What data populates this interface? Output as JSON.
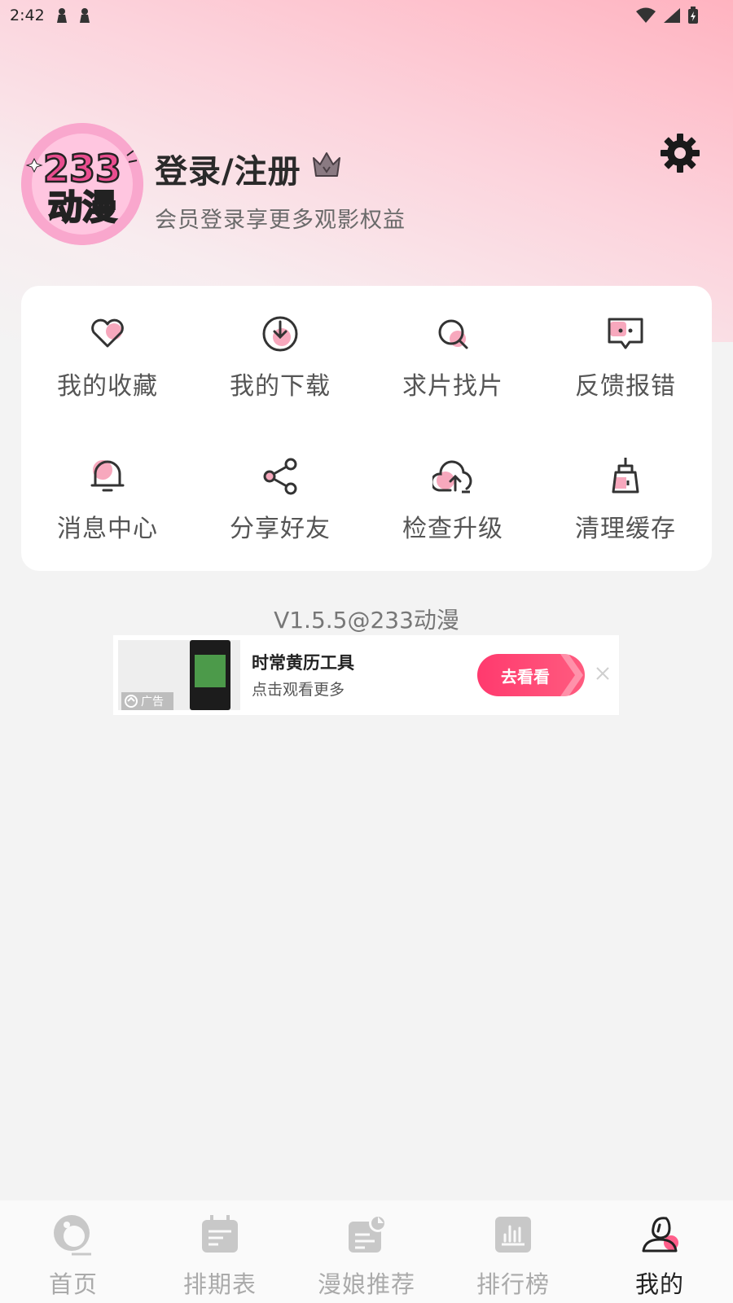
{
  "status_bar": {
    "time": "2:42"
  },
  "profile": {
    "avatar_text_top": "233",
    "avatar_text_bottom": "动漫",
    "login_label": "登录/注册",
    "subtitle": "会员登录享更多观影权益"
  },
  "menu": [
    {
      "label": "我的收藏",
      "icon": "heart-icon"
    },
    {
      "label": "我的下载",
      "icon": "download-icon"
    },
    {
      "label": "求片找片",
      "icon": "search-icon"
    },
    {
      "label": "反馈报错",
      "icon": "feedback-icon"
    },
    {
      "label": "消息中心",
      "icon": "bell-icon"
    },
    {
      "label": "分享好友",
      "icon": "share-icon"
    },
    {
      "label": "检查升级",
      "icon": "upgrade-icon"
    },
    {
      "label": "清理缓存",
      "icon": "broom-icon"
    }
  ],
  "version": "V1.5.5@233动漫",
  "ad": {
    "badge": "广告",
    "title": "时常黄历工具",
    "subtitle": "点击观看更多",
    "cta": "去看看"
  },
  "nav": [
    {
      "label": "首页",
      "icon": "home-icon",
      "active": false
    },
    {
      "label": "排期表",
      "icon": "calendar-icon",
      "active": false
    },
    {
      "label": "漫娘推荐",
      "icon": "recommend-icon",
      "active": false
    },
    {
      "label": "排行榜",
      "icon": "ranking-icon",
      "active": false
    },
    {
      "label": "我的",
      "icon": "profile-icon",
      "active": true
    }
  ],
  "colors": {
    "accent": "#ff4d7d",
    "pink_light": "#f7a8bd",
    "text_dark": "#2a2a2a",
    "text_muted": "#777777"
  }
}
